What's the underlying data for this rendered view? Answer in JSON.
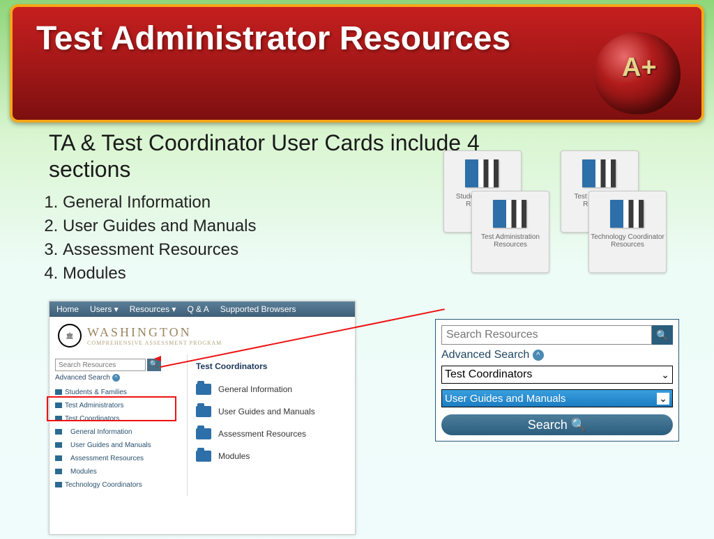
{
  "header": {
    "title": "Test Administrator Resources",
    "apple_grade": "A+"
  },
  "subtitle": "TA & Test Coordinator User Cards include 4 sections",
  "sections": [
    "General Information",
    "User Guides and Manuals",
    "Assessment Resources",
    "Modules"
  ],
  "cards": [
    "Student & Family Resources",
    "Test Administration Resources",
    "Test Coordinator Resources",
    "Technology Coordinator Resources"
  ],
  "portal": {
    "nav": [
      "Home",
      "Users ▾",
      "Resources ▾",
      "Q & A",
      "Supported Browsers"
    ],
    "logo_main": "WASHINGTON",
    "logo_sub": "COMPREHENSIVE ASSESSMENT PROGRAM",
    "search_placeholder": "Search Resources",
    "advanced": "Advanced Search",
    "side": [
      "Students & Families",
      "Test Administrators",
      "Test Coordinators",
      "General Information",
      "User Guides and Manuals",
      "Assessment Resources",
      "Modules",
      "Technology Coordinators"
    ],
    "right_heading": "Test Coordinators",
    "right_items": [
      "General Information",
      "User Guides and Manuals",
      "Assessment Resources",
      "Modules"
    ]
  },
  "searchbox": {
    "placeholder": "Search Resources",
    "advanced": "Advanced Search",
    "select1": "Test Coordinators",
    "select2": "User Guides and Manuals",
    "button": "Search"
  }
}
